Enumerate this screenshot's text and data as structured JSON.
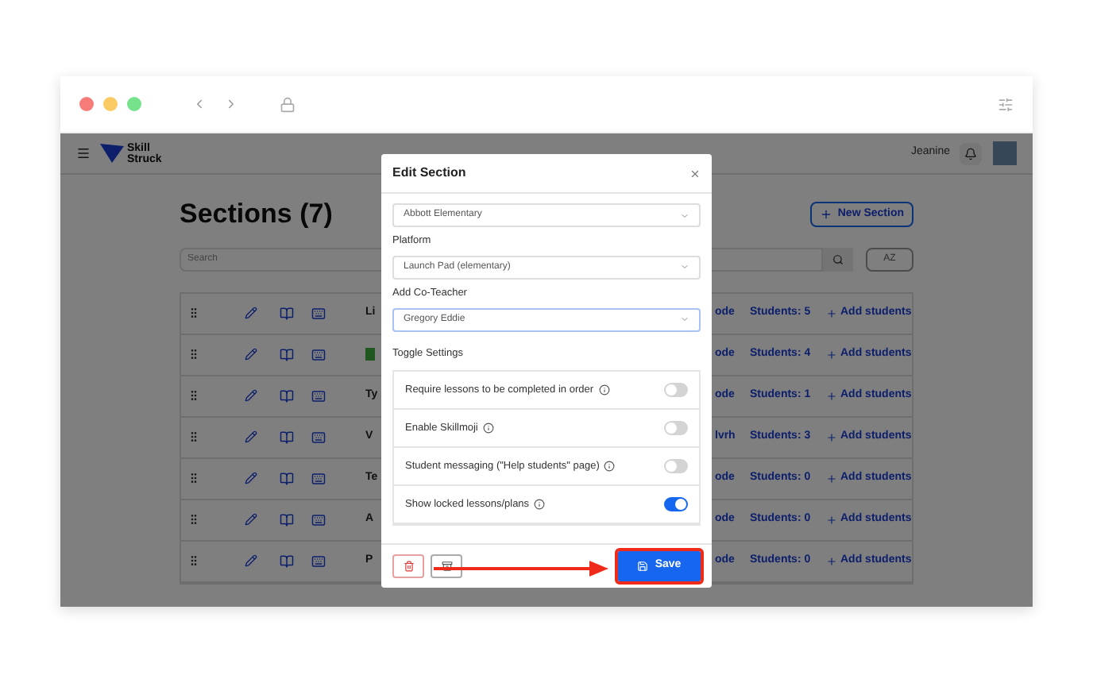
{
  "header": {
    "logo_text": [
      "Skill",
      "Struck"
    ],
    "user_name": "Jeanine"
  },
  "page": {
    "title": "Sections (7)",
    "new_button": "New Section",
    "search": {
      "placeholder": "Search"
    },
    "sort_button": "AZ"
  },
  "rows": [
    {
      "name": "Li",
      "badge": false,
      "code": "ode",
      "students": "Students: 5",
      "add": "Add students"
    },
    {
      "badge": true,
      "code": "ode",
      "students": "Students: 4",
      "add": "Add students"
    },
    {
      "name": "Ty",
      "badge": false,
      "code": "ode",
      "students": "Students: 1",
      "add": "Add students"
    },
    {
      "name": "V",
      "badge": false,
      "code": "lvrh",
      "students": "Students: 3",
      "add": "Add students"
    },
    {
      "name": "Te",
      "badge": false,
      "code": "ode",
      "students": "Students: 0",
      "add": "Add students"
    },
    {
      "name": "A",
      "badge": false,
      "code": "ode",
      "students": "Students: 0",
      "add": "Add students"
    },
    {
      "name": "P",
      "badge": false,
      "code": "ode",
      "students": "Students: 0",
      "add": "Add students"
    }
  ],
  "modal": {
    "title": "Edit Section",
    "selects": [
      {
        "value": "Abbott Elementary",
        "focused": false
      },
      {
        "label": "Platform",
        "value": "Launch Pad (elementary)",
        "focused": false
      },
      {
        "label": "Add Co-Teacher",
        "value": "Gregory Eddie",
        "focused": true
      }
    ],
    "toggle_heading": "Toggle Settings",
    "toggles": [
      {
        "label": "Require lessons to be completed in order",
        "on": false
      },
      {
        "label": "Enable Skillmoji",
        "on": false
      },
      {
        "label": "Student messaging (\"Help students\" page)",
        "on": false
      },
      {
        "label": "Show locked lessons/plans",
        "on": true
      }
    ],
    "save_button": "Save"
  }
}
